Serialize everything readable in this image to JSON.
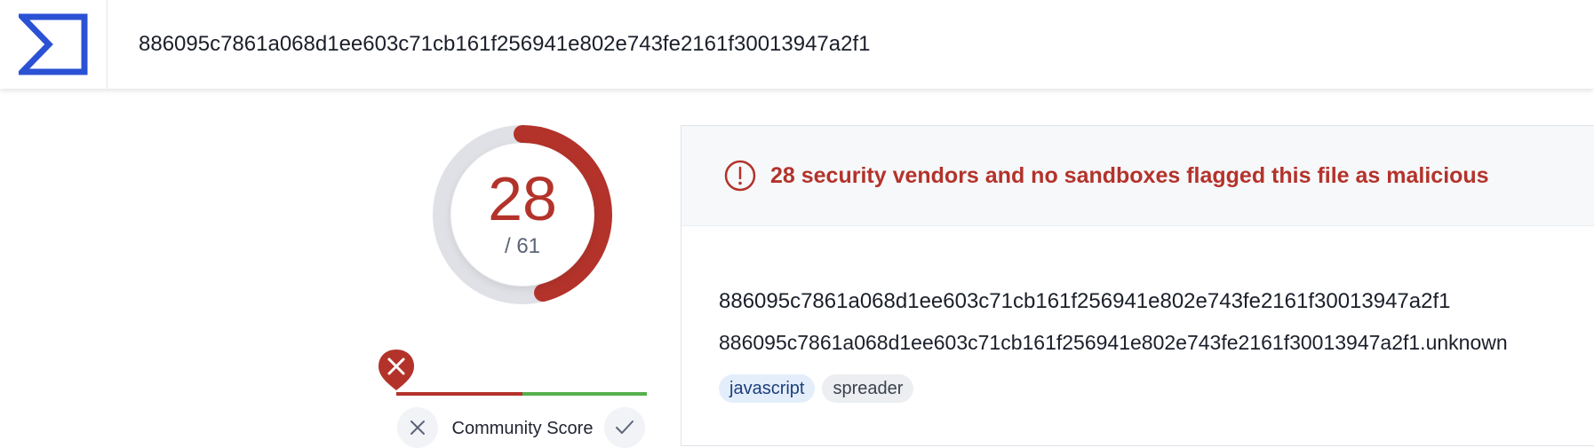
{
  "header": {
    "search_value": "886095c7861a068d1ee603c71cb161f256941e802e743fe2161f30013947a2f1",
    "logo_icon": "sigma-logo-icon"
  },
  "detection": {
    "score": "28",
    "total": "/ 61",
    "ratio": 0.459,
    "accent_color": "#b3332b"
  },
  "community": {
    "label": "Community Score",
    "marker_icon": "close-icon",
    "down_icon": "x-icon",
    "up_icon": "check-icon",
    "negative_color": "#b3332b",
    "positive_color": "#55b04e"
  },
  "result": {
    "banner_icon": "alert-circle-icon",
    "banner_text": "28 security vendors and no sandboxes flagged this file as malicious",
    "hash": "886095c7861a068d1ee603c71cb161f256941e802e743fe2161f30013947a2f1",
    "filename": "886095c7861a068d1ee603c71cb161f256941e802e743fe2161f30013947a2f1.unknown",
    "tags": [
      "javascript",
      "spreader"
    ]
  }
}
